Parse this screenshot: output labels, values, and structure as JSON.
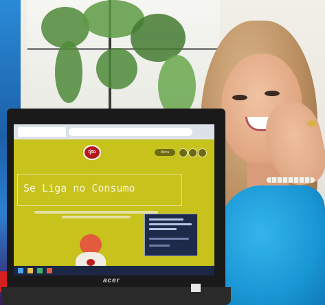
{
  "scene": {
    "laptop_brand": "acer",
    "laptop_screen": {
      "site_logo_text": "tjto",
      "nav_pill_label": "Menu",
      "hero_title": "Se Liga no Consumo"
    }
  },
  "colors": {
    "site_background": "#c7c21c",
    "logo_red": "#b3171c",
    "blouse_blue": "#1a98d6",
    "poster_blue": "#1c5fa8"
  }
}
